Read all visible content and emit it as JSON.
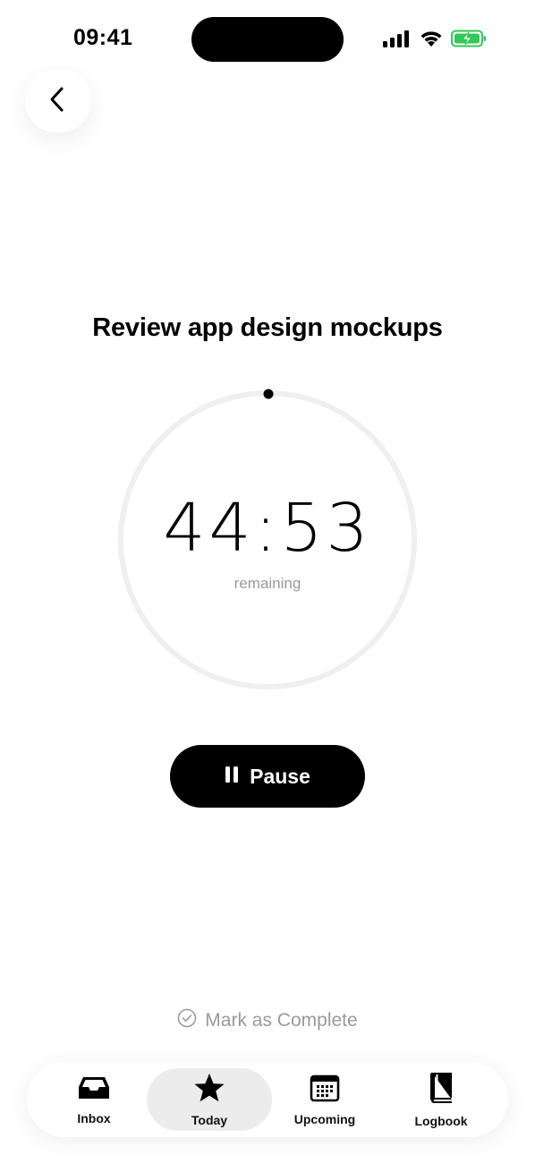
{
  "status_bar": {
    "time": "09:41",
    "signal_icon": "cellular-signal-icon",
    "wifi_icon": "wifi-icon",
    "battery_icon": "battery-charging-icon",
    "battery_color": "#34c759"
  },
  "back_icon": "chevron-left-icon",
  "task": {
    "title": "Review app design mockups"
  },
  "timer": {
    "value": "44:53",
    "caption": "remaining"
  },
  "pause_button": {
    "icon": "pause-icon",
    "label": "Pause"
  },
  "mark_complete": {
    "icon": "check-circle-icon",
    "label": "Mark as Complete"
  },
  "tab_bar": {
    "items": [
      {
        "label": "Inbox",
        "icon": "inbox-icon",
        "active": false
      },
      {
        "label": "Today",
        "icon": "star-icon",
        "active": true
      },
      {
        "label": "Upcoming",
        "icon": "calendar-icon",
        "active": false
      },
      {
        "label": "Logbook",
        "icon": "book-icon",
        "active": false
      }
    ]
  },
  "colors": {
    "primary": "#000000",
    "muted": "#9a9a9a",
    "ring_track": "#efefef",
    "active_tab_bg": "#ececec"
  }
}
